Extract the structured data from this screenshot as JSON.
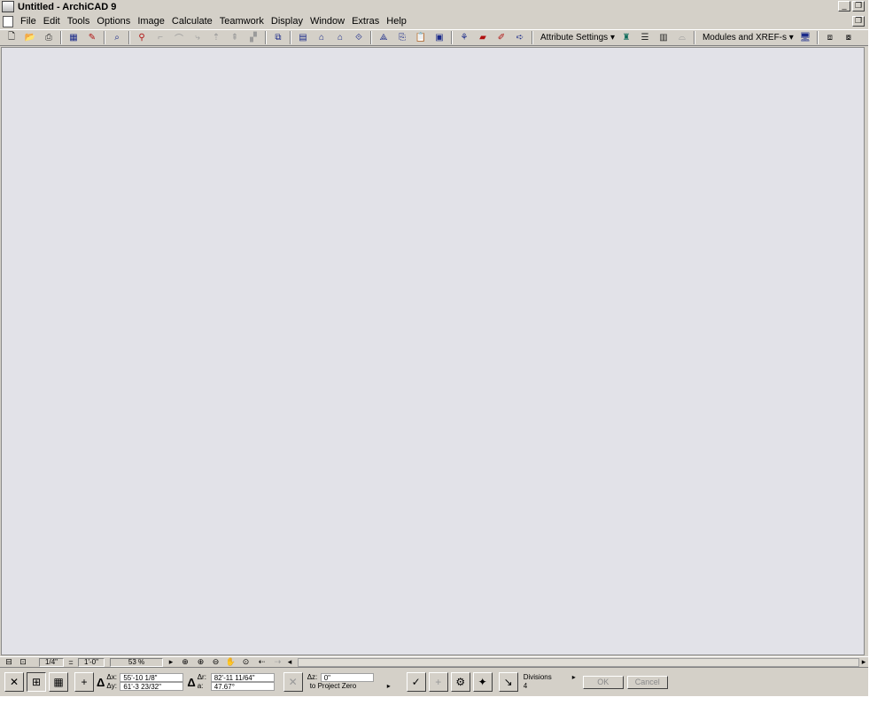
{
  "window": {
    "title": "Untitled - ArchiCAD 9"
  },
  "menu": [
    "File",
    "Edit",
    "Tools",
    "Options",
    "Image",
    "Calculate",
    "Teamwork",
    "Display",
    "Window",
    "Extras",
    "Help"
  ],
  "toolbar": {
    "attribute_settings": "Attribute Settings",
    "modules_xrefs": "Modules and XREF-s",
    "dropdown_arrow": "▾"
  },
  "zoombar": {
    "scale": "1/4\"",
    "equals": "=",
    "scale_value": "1'-0\"",
    "zoom": "53 %"
  },
  "infobox": {
    "dx_label": "Δx:",
    "dx": "55'-10 1/8\"",
    "dy_label": "Δy:",
    "dy": "61'-3 23/32\"",
    "dr_label": "Δr:",
    "dr": "82'-11 11/64\"",
    "angle_label": "a:",
    "angle": "47.67°",
    "dz_label": "Δz:",
    "dz": "0\"",
    "reference": "to Project Zero",
    "divisions_label": "Divisions",
    "divisions": "4",
    "ok": "OK",
    "cancel": "Cancel"
  }
}
